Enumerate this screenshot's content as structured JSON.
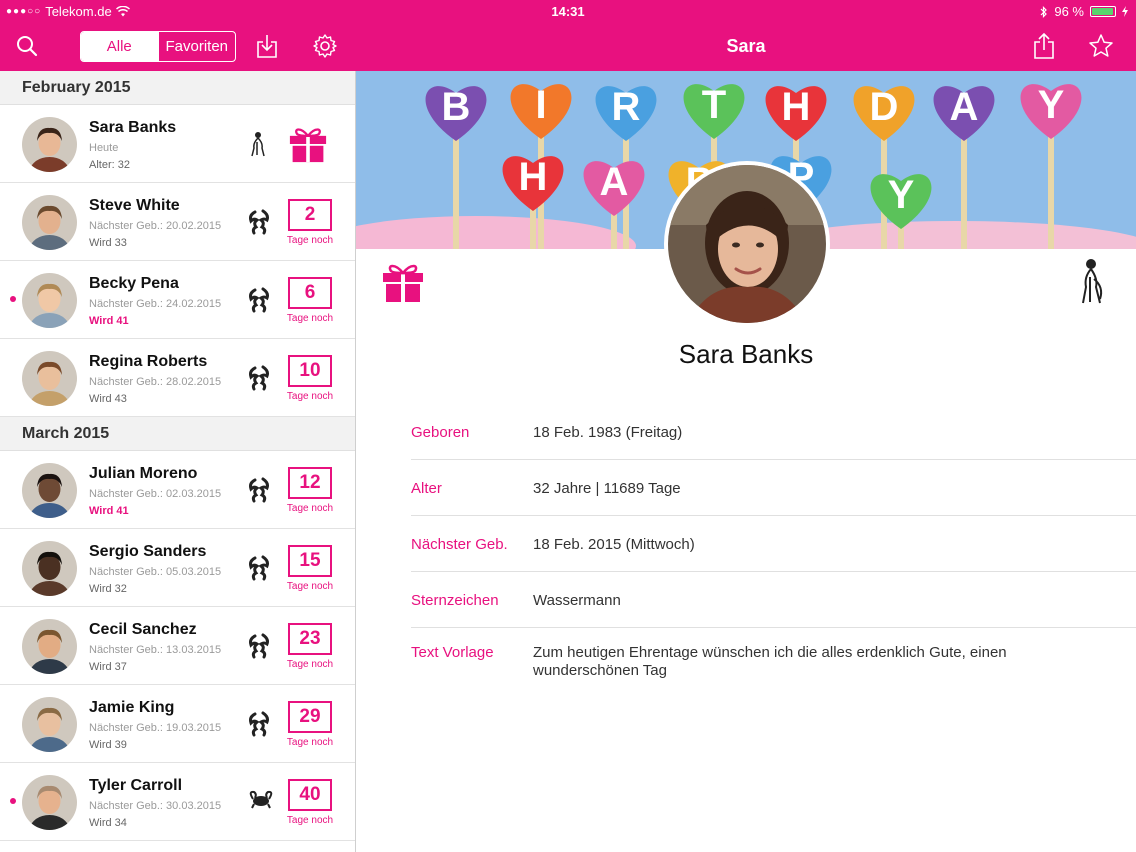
{
  "status": {
    "carrier": "Telekom.de",
    "time": "14:31",
    "battery": "96 %",
    "battery_level": 0.96
  },
  "nav": {
    "segments": [
      "Alle",
      "Favoriten"
    ],
    "title": "Sara"
  },
  "colors": {
    "accent": "#e8117f",
    "section_bg": "#f2f2f2"
  },
  "list": {
    "sections": [
      {
        "title": "February 2015",
        "rows": [
          {
            "name": "Sara Banks",
            "sub": "Heute",
            "age": "Alter: 32",
            "highlight": false,
            "dot": false,
            "zodiac": "aquarius-icon",
            "gift": true,
            "days": "",
            "days_label": ""
          },
          {
            "name": "Steve White",
            "sub": "Nächster Geb.: 20.02.2015",
            "age": "Wird 33",
            "highlight": false,
            "dot": false,
            "zodiac": "pisces-icon",
            "gift": false,
            "days": "2",
            "days_label": "Tage noch"
          },
          {
            "name": "Becky Pena",
            "sub": "Nächster Geb.: 24.02.2015",
            "age": "Wird 41",
            "highlight": true,
            "dot": true,
            "zodiac": "pisces-icon",
            "gift": false,
            "days": "6",
            "days_label": "Tage noch"
          },
          {
            "name": "Regina Roberts",
            "sub": "Nächster Geb.: 28.02.2015",
            "age": "Wird 43",
            "highlight": false,
            "dot": false,
            "zodiac": "pisces-icon",
            "gift": false,
            "days": "10",
            "days_label": "Tage noch"
          }
        ]
      },
      {
        "title": "March 2015",
        "rows": [
          {
            "name": "Julian Moreno",
            "sub": "Nächster Geb.: 02.03.2015",
            "age": "Wird 41",
            "highlight": true,
            "dot": false,
            "zodiac": "pisces-icon",
            "gift": false,
            "days": "12",
            "days_label": "Tage noch"
          },
          {
            "name": "Sergio Sanders",
            "sub": "Nächster Geb.: 05.03.2015",
            "age": "Wird 32",
            "highlight": false,
            "dot": false,
            "zodiac": "pisces-icon",
            "gift": false,
            "days": "15",
            "days_label": "Tage noch"
          },
          {
            "name": "Cecil Sanchez",
            "sub": "Nächster Geb.: 13.03.2015",
            "age": "Wird 37",
            "highlight": false,
            "dot": false,
            "zodiac": "pisces-icon",
            "gift": false,
            "days": "23",
            "days_label": "Tage noch"
          },
          {
            "name": "Jamie King",
            "sub": "Nächster Geb.: 19.03.2015",
            "age": "Wird 39",
            "highlight": false,
            "dot": false,
            "zodiac": "pisces-icon",
            "gift": false,
            "days": "29",
            "days_label": "Tage noch"
          },
          {
            "name": "Tyler Carroll",
            "sub": "Nächster Geb.: 30.03.2015",
            "age": "Wird 34",
            "highlight": false,
            "dot": true,
            "zodiac": "aries-icon",
            "gift": false,
            "days": "40",
            "days_label": "Tage noch"
          }
        ]
      }
    ]
  },
  "detail": {
    "banner_letters": [
      "B",
      "I",
      "R",
      "T",
      "H",
      "D",
      "A",
      "Y",
      "H",
      "A",
      "P",
      "P",
      "Y"
    ],
    "name": "Sara Banks",
    "info": [
      {
        "label": "Geboren",
        "value": "18 Feb. 1983 (Freitag)"
      },
      {
        "label": "Alter",
        "value": "32 Jahre | 11689 Tage"
      },
      {
        "label": "Nächster Geb.",
        "value": "18 Feb. 2015 (Mittwoch)"
      },
      {
        "label": "Sternzeichen",
        "value": "Wassermann"
      },
      {
        "label": "Text Vorlage",
        "value": "Zum heutigen Ehrentage wünschen ich die alles erdenklich Gute, einen wunderschönen Tag"
      }
    ]
  }
}
